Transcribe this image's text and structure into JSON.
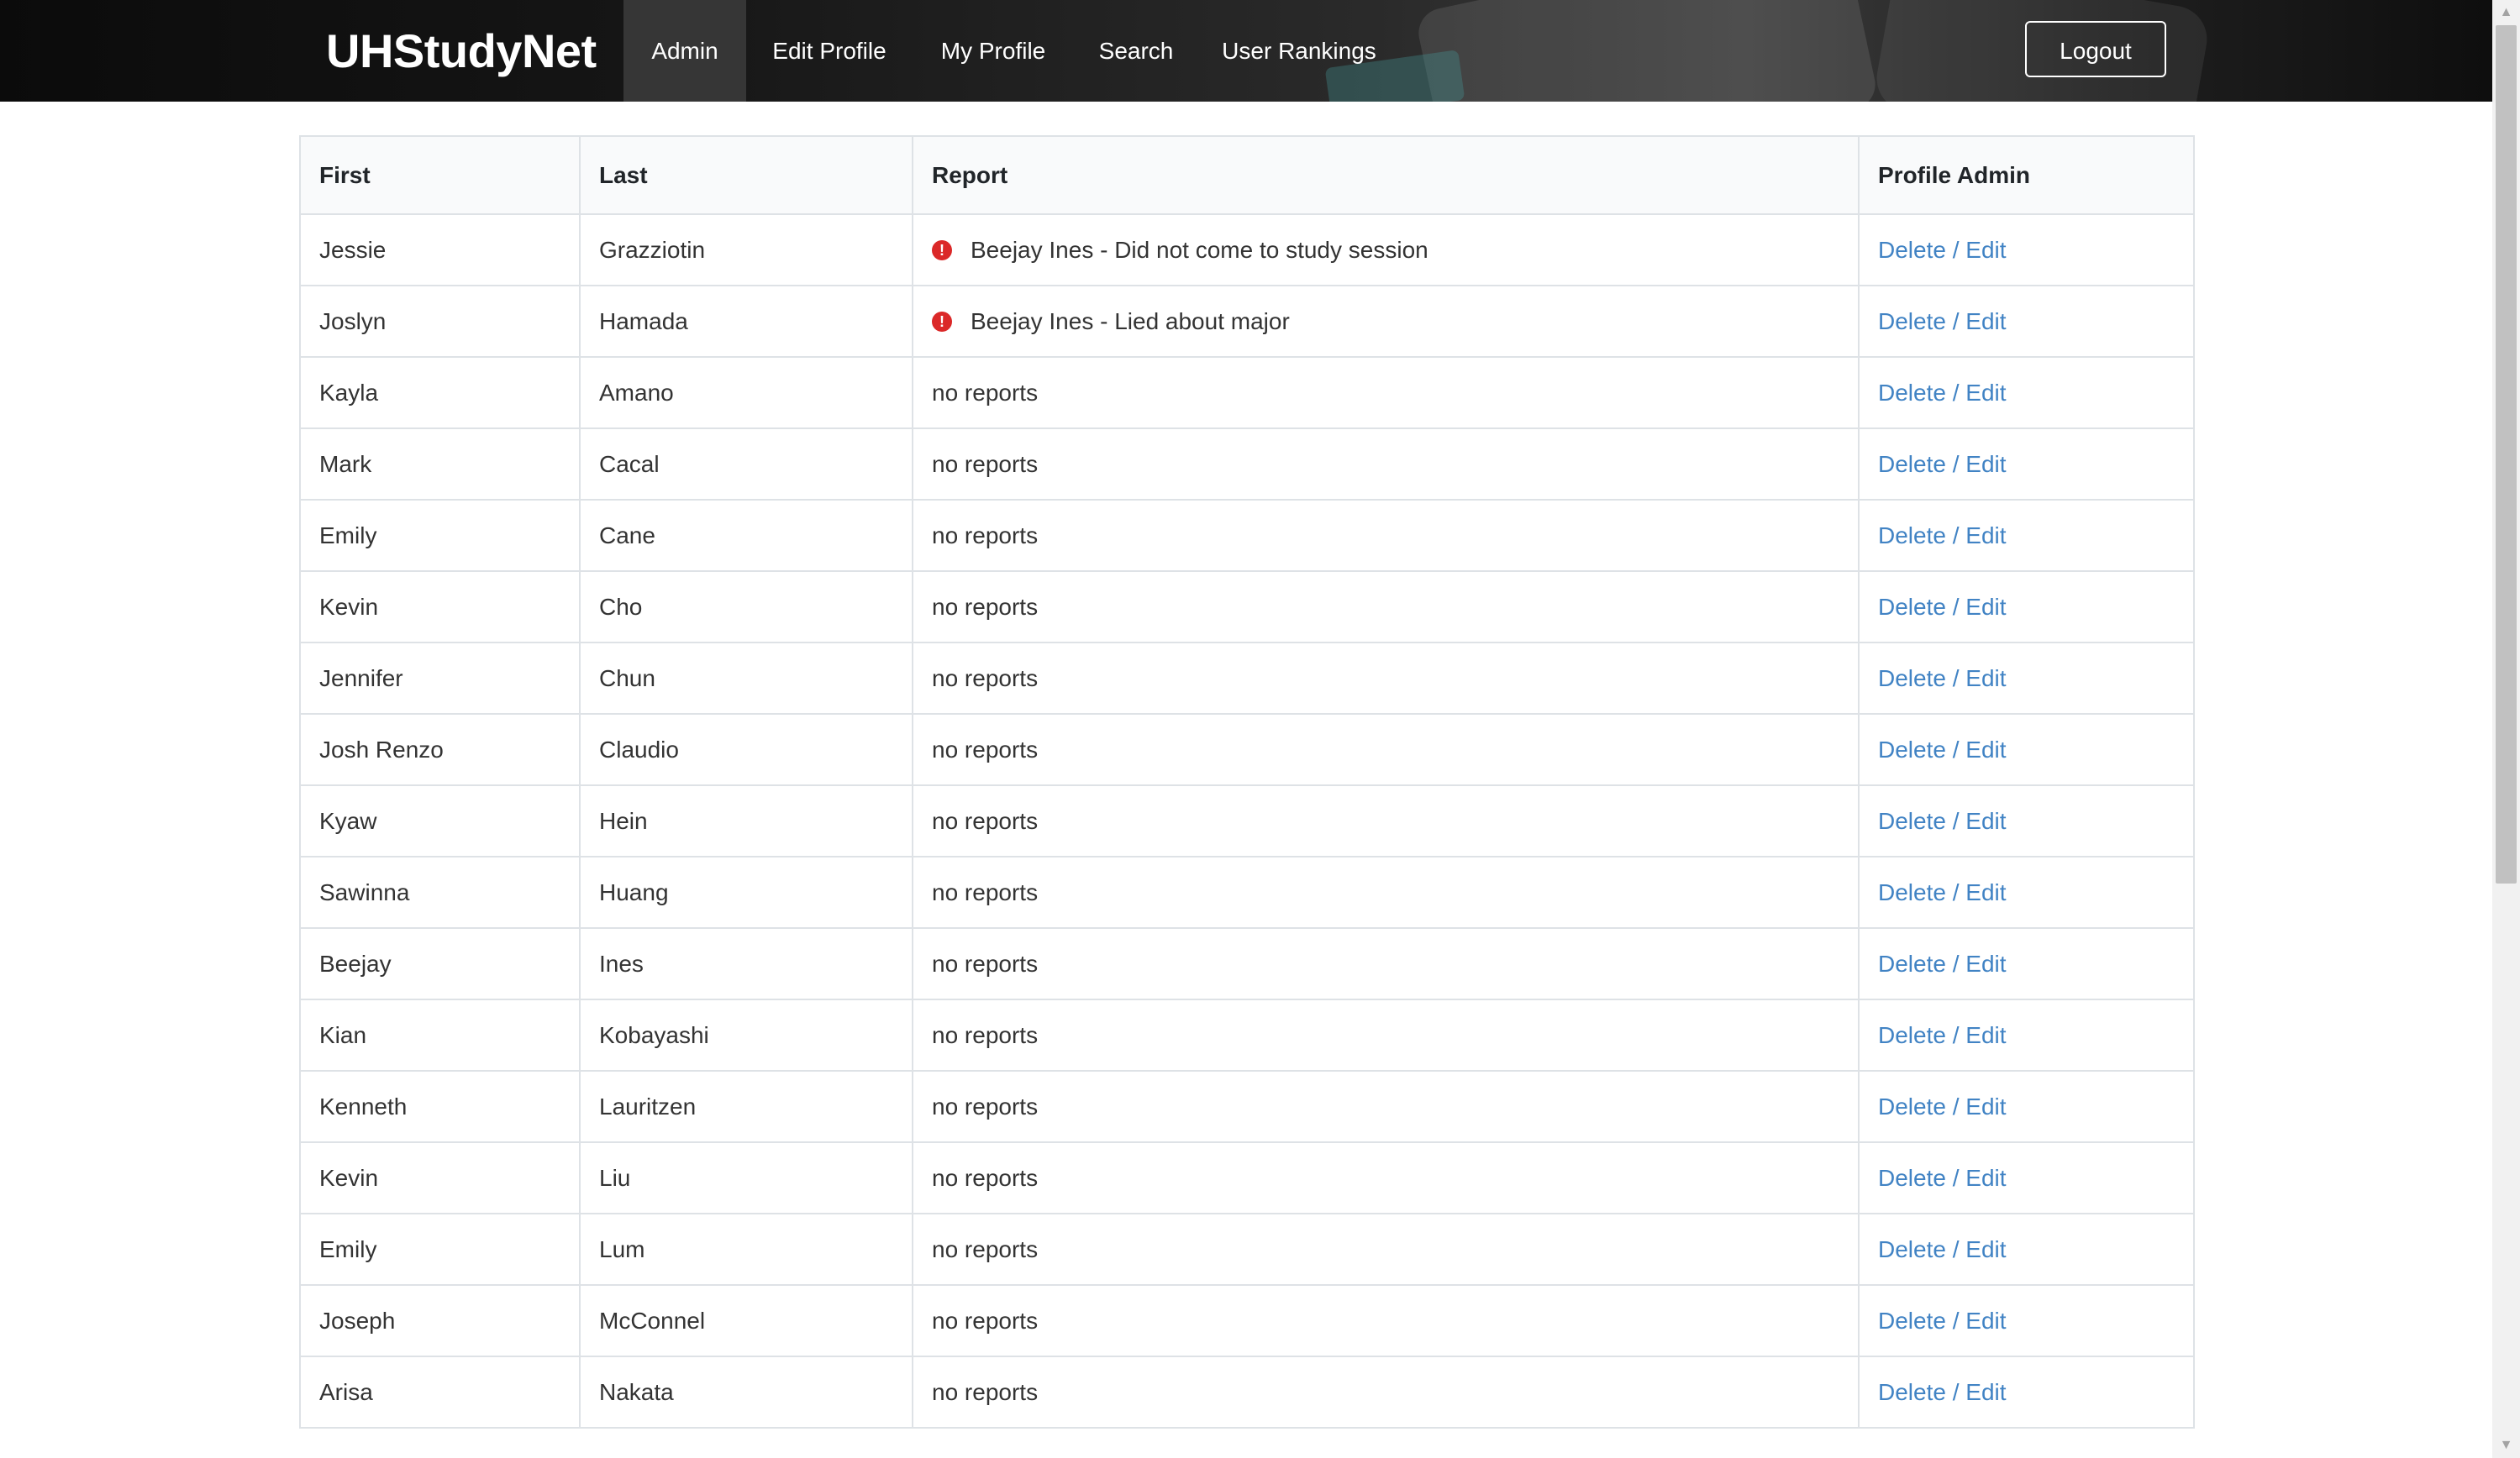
{
  "nav": {
    "brand": "UHStudyNet",
    "items": [
      {
        "label": "Admin",
        "active": true
      },
      {
        "label": "Edit Profile",
        "active": false
      },
      {
        "label": "My Profile",
        "active": false
      },
      {
        "label": "Search",
        "active": false
      },
      {
        "label": "User Rankings",
        "active": false
      }
    ],
    "logout_label": "Logout"
  },
  "table": {
    "headers": {
      "first": "First",
      "last": "Last",
      "report": "Report",
      "admin": "Profile Admin"
    },
    "rows": [
      {
        "first": "Jessie",
        "last": "Grazziotin",
        "report": "Beejay Ines - Did not come to study session",
        "reported": true,
        "action": "Delete / Edit"
      },
      {
        "first": "Joslyn",
        "last": "Hamada",
        "report": "Beejay Ines - Lied about major",
        "reported": true,
        "action": "Delete / Edit"
      },
      {
        "first": "Kayla",
        "last": "Amano",
        "report": "no reports",
        "reported": false,
        "action": "Delete / Edit"
      },
      {
        "first": "Mark",
        "last": "Cacal",
        "report": "no reports",
        "reported": false,
        "action": "Delete / Edit"
      },
      {
        "first": "Emily",
        "last": "Cane",
        "report": "no reports",
        "reported": false,
        "action": "Delete / Edit"
      },
      {
        "first": "Kevin",
        "last": "Cho",
        "report": "no reports",
        "reported": false,
        "action": "Delete / Edit"
      },
      {
        "first": "Jennifer",
        "last": "Chun",
        "report": "no reports",
        "reported": false,
        "action": "Delete / Edit"
      },
      {
        "first": "Josh Renzo",
        "last": "Claudio",
        "report": "no reports",
        "reported": false,
        "action": "Delete / Edit"
      },
      {
        "first": "Kyaw",
        "last": "Hein",
        "report": "no reports",
        "reported": false,
        "action": "Delete / Edit"
      },
      {
        "first": "Sawinna",
        "last": "Huang",
        "report": "no reports",
        "reported": false,
        "action": "Delete / Edit"
      },
      {
        "first": "Beejay",
        "last": "Ines",
        "report": "no reports",
        "reported": false,
        "action": "Delete / Edit"
      },
      {
        "first": "Kian",
        "last": "Kobayashi",
        "report": "no reports",
        "reported": false,
        "action": "Delete / Edit"
      },
      {
        "first": "Kenneth",
        "last": "Lauritzen",
        "report": "no reports",
        "reported": false,
        "action": "Delete / Edit"
      },
      {
        "first": "Kevin",
        "last": "Liu",
        "report": "no reports",
        "reported": false,
        "action": "Delete / Edit"
      },
      {
        "first": "Emily",
        "last": "Lum",
        "report": "no reports",
        "reported": false,
        "action": "Delete / Edit"
      },
      {
        "first": "Joseph",
        "last": "McConnel",
        "report": "no reports",
        "reported": false,
        "action": "Delete / Edit"
      },
      {
        "first": "Arisa",
        "last": "Nakata",
        "report": "no reports",
        "reported": false,
        "action": "Delete / Edit"
      }
    ]
  },
  "colors": {
    "link": "#4183c4",
    "warning": "#db2828",
    "nav_bg": "#1b1c1d"
  }
}
